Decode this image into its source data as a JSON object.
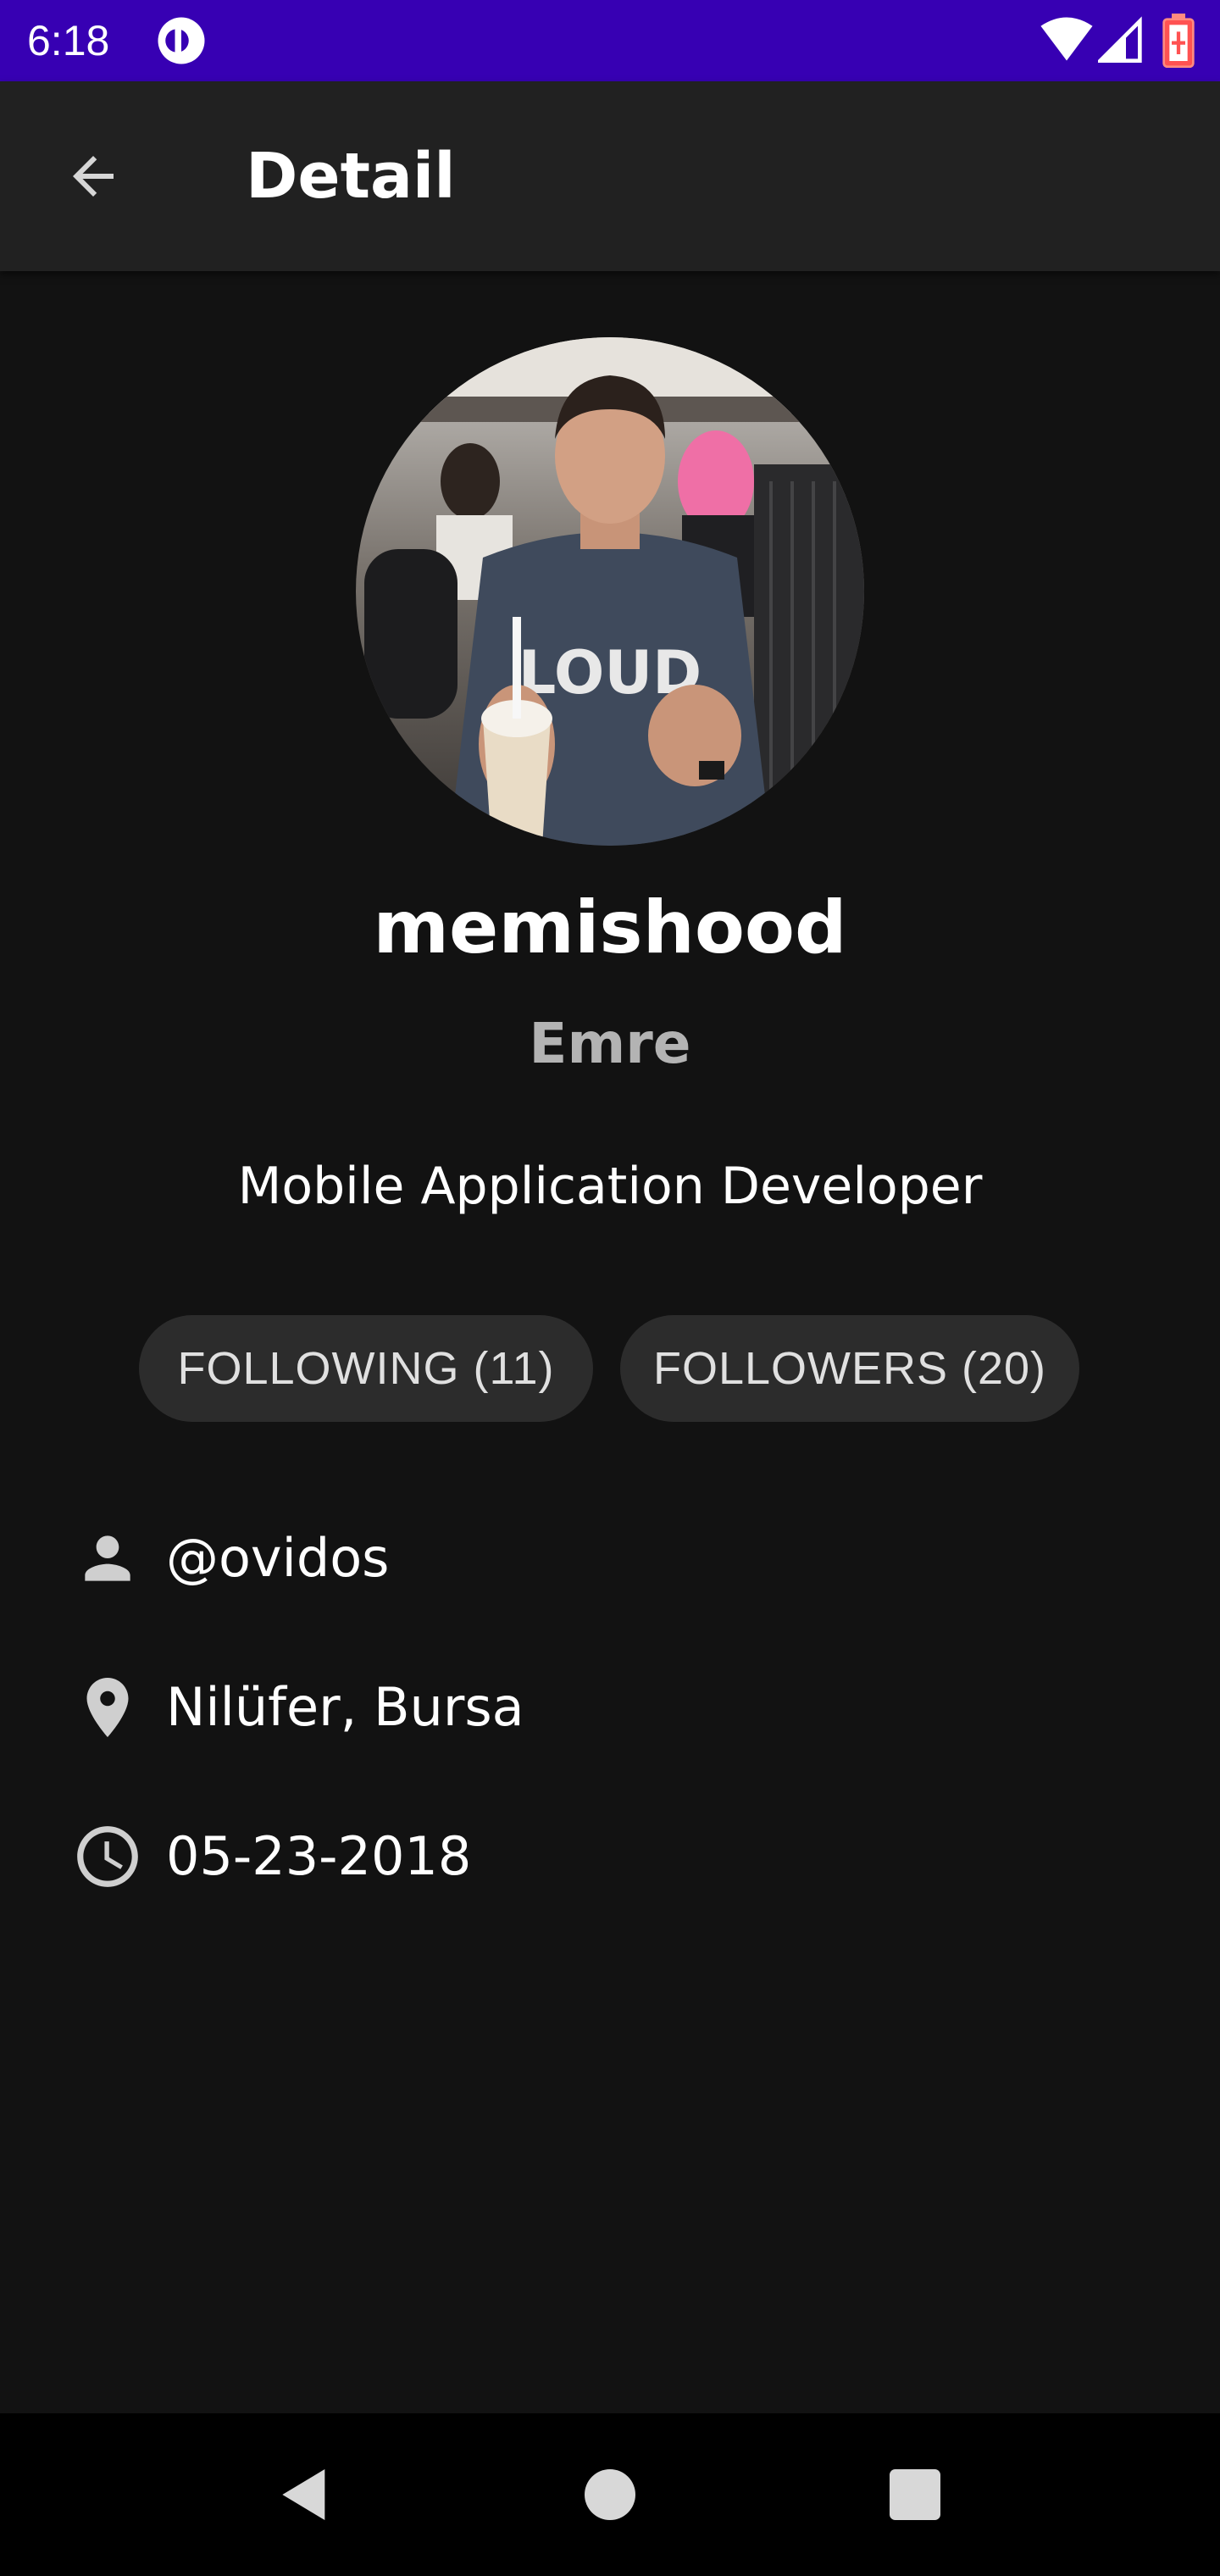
{
  "status_bar": {
    "time": "6:18",
    "background_color": "#3700b3",
    "icons": [
      "app-notification-icon",
      "wifi-icon",
      "signal-icon",
      "battery-icon"
    ]
  },
  "app_bar": {
    "title": "Detail",
    "back_icon": "arrow-back-icon"
  },
  "profile": {
    "avatar_alt": "Profile photo",
    "username": "memishood",
    "name": "Emre",
    "bio": "Mobile Application Developer"
  },
  "chips": {
    "following": "FOLLOWING (11)",
    "followers": "FOLLOWERS (20)"
  },
  "info": {
    "login": {
      "icon": "person-icon",
      "text": "@ovidos"
    },
    "location": {
      "icon": "location-pin-icon",
      "text": "Nilüfer, Bursa"
    },
    "date": {
      "icon": "clock-icon",
      "text": "05-23-2018"
    }
  },
  "nav_bar": {
    "icons": [
      "nav-back-icon",
      "nav-home-icon",
      "nav-recents-icon"
    ]
  },
  "colors": {
    "background": "#121212",
    "app_bar": "#212121",
    "chip": "#2c2c2c",
    "status_bar": "#3700b3"
  }
}
